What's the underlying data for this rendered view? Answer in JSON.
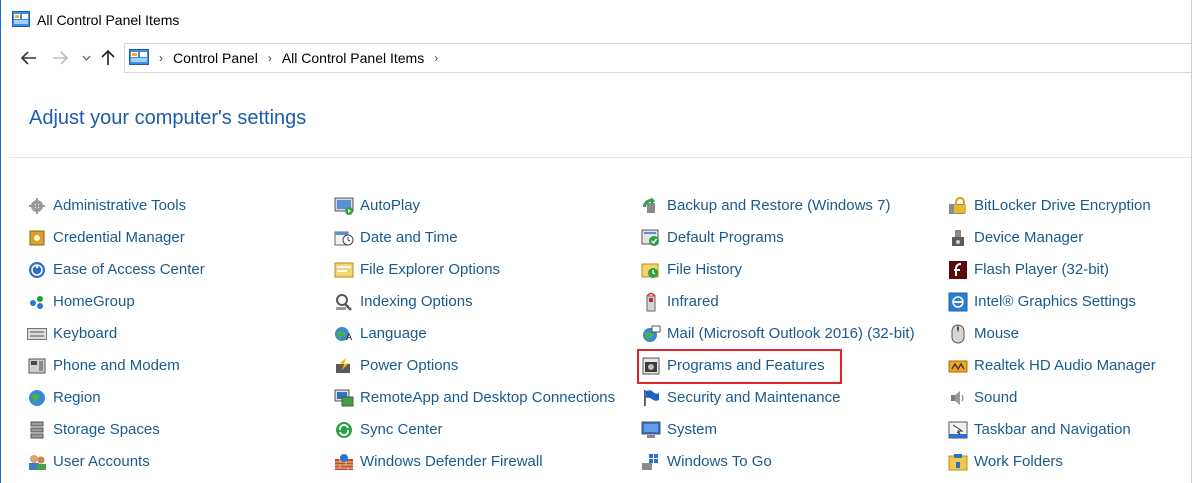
{
  "window": {
    "title": "All Control Panel Items"
  },
  "breadcrumb": {
    "items": [
      "Control Panel",
      "All Control Panel Items"
    ]
  },
  "heading": "Adjust your computer's settings",
  "columns": [
    [
      {
        "label": "Administrative Tools",
        "icon": "administrative-tools-icon"
      },
      {
        "label": "Credential Manager",
        "icon": "credential-manager-icon"
      },
      {
        "label": "Ease of Access Center",
        "icon": "ease-of-access-icon"
      },
      {
        "label": "HomeGroup",
        "icon": "homegroup-icon"
      },
      {
        "label": "Keyboard",
        "icon": "keyboard-icon"
      },
      {
        "label": "Phone and Modem",
        "icon": "phone-modem-icon"
      },
      {
        "label": "Region",
        "icon": "region-icon"
      },
      {
        "label": "Storage Spaces",
        "icon": "storage-spaces-icon"
      },
      {
        "label": "User Accounts",
        "icon": "user-accounts-icon"
      }
    ],
    [
      {
        "label": "AutoPlay",
        "icon": "autoplay-icon"
      },
      {
        "label": "Date and Time",
        "icon": "date-time-icon"
      },
      {
        "label": "File Explorer Options",
        "icon": "folder-options-icon"
      },
      {
        "label": "Indexing Options",
        "icon": "indexing-icon"
      },
      {
        "label": "Language",
        "icon": "language-icon"
      },
      {
        "label": "Power Options",
        "icon": "power-options-icon"
      },
      {
        "label": "RemoteApp and Desktop Connections",
        "icon": "remoteapp-icon"
      },
      {
        "label": "Sync Center",
        "icon": "sync-center-icon"
      },
      {
        "label": "Windows Defender Firewall",
        "icon": "firewall-icon"
      }
    ],
    [
      {
        "label": "Backup and Restore (Windows 7)",
        "icon": "backup-restore-icon"
      },
      {
        "label": "Default Programs",
        "icon": "default-programs-icon"
      },
      {
        "label": "File History",
        "icon": "file-history-icon"
      },
      {
        "label": "Infrared",
        "icon": "infrared-icon"
      },
      {
        "label": "Mail (Microsoft Outlook 2016) (32-bit)",
        "icon": "mail-icon"
      },
      {
        "label": "Programs and Features",
        "icon": "programs-features-icon"
      },
      {
        "label": "Security and Maintenance",
        "icon": "security-flag-icon"
      },
      {
        "label": "System",
        "icon": "system-icon"
      },
      {
        "label": "Windows To Go",
        "icon": "windows-to-go-icon"
      }
    ],
    [
      {
        "label": "BitLocker Drive Encryption",
        "icon": "bitlocker-icon"
      },
      {
        "label": "Device Manager",
        "icon": "device-manager-icon"
      },
      {
        "label": "Flash Player (32-bit)",
        "icon": "flash-player-icon"
      },
      {
        "label": "Intel® Graphics Settings",
        "icon": "intel-graphics-icon"
      },
      {
        "label": "Mouse",
        "icon": "mouse-icon"
      },
      {
        "label": "Realtek HD Audio Manager",
        "icon": "realtek-audio-icon"
      },
      {
        "label": "Sound",
        "icon": "sound-icon"
      },
      {
        "label": "Taskbar and Navigation",
        "icon": "taskbar-icon"
      },
      {
        "label": "Work Folders",
        "icon": "work-folders-icon"
      }
    ]
  ],
  "highlighted_item": "Programs and Features",
  "colors": {
    "link": "#1a5b8e",
    "heading": "#1e5ba8",
    "highlight_border": "#e0242a"
  }
}
